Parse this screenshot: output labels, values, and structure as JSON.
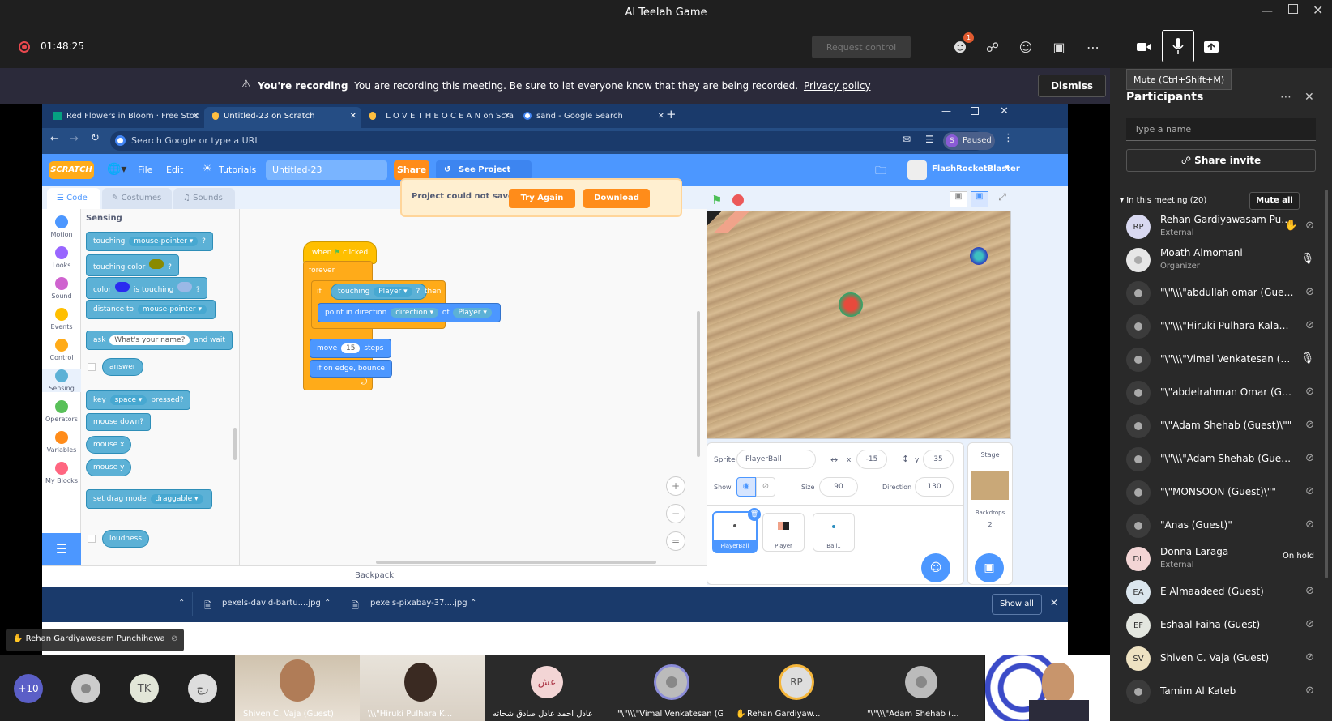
{
  "window": {
    "title": "Al Teelah Game"
  },
  "meeting": {
    "timer": "01:48:25",
    "request_control": "Request control",
    "people_badge": "1",
    "mute_tooltip": "Mute (Ctrl+Shift+M)"
  },
  "recording": {
    "bold": "You're recording",
    "text": "You are recording this meeting. Be sure to let everyone know that they are being recorded.",
    "link": "Privacy policy",
    "dismiss": "Dismiss"
  },
  "browser": {
    "tabs": [
      {
        "label": "Red Flowers in Bloom · Free Stoc"
      },
      {
        "label": "Untitled-23 on Scratch"
      },
      {
        "label": "I L O V E T H E O C E A N on Scra"
      },
      {
        "label": "sand - Google Search"
      }
    ],
    "address_placeholder": "Search Google or type a URL",
    "profile_label": "Paused",
    "profile_initial": "S"
  },
  "scratch": {
    "logo": "SCRATCH",
    "menu_file": "File",
    "menu_edit": "Edit",
    "menu_tutorials": "Tutorials",
    "project_title": "Untitled-23",
    "share": "Share",
    "see_project": "See Project Page",
    "username": "FlashRocketBlaster",
    "tab_code": "Code",
    "tab_costumes": "Costumes",
    "tab_sounds": "Sounds",
    "alert_text": "Project could not save.",
    "try_again": "Try Again",
    "download": "Download",
    "categories": [
      "Motion",
      "Looks",
      "Sound",
      "Events",
      "Control",
      "Sensing",
      "Operators",
      "Variables",
      "My Blocks"
    ],
    "category_colors": [
      "#4c97ff",
      "#9966ff",
      "#cf63cf",
      "#ffbf00",
      "#ffab19",
      "#5cb1d6",
      "#59c059",
      "#ff8c1a",
      "#ff6680"
    ],
    "palette_heading": "Sensing",
    "blocks": {
      "touching": "touching",
      "mouse_pointer": "mouse-pointer",
      "touching_color": "touching color",
      "color": "color",
      "is_touching": "is touching",
      "distance_to": "distance to",
      "ask": "ask",
      "ask_default": "What's your name?",
      "and_wait": "and wait",
      "answer": "answer",
      "key": "key",
      "space": "space",
      "pressed": "pressed?",
      "mouse_down": "mouse down?",
      "mouse_x": "mouse x",
      "mouse_y": "mouse y",
      "set_drag_mode": "set drag mode",
      "draggable": "draggable",
      "loudness": "loudness",
      "q": "?"
    },
    "script": {
      "when": "when",
      "clicked": "clicked",
      "forever": "forever",
      "if": "if",
      "touching": "touching",
      "player": "Player",
      "q": "?",
      "then": "then",
      "point_in_direction": "point in direction",
      "direction": "direction",
      "of": "of",
      "move": "move",
      "steps_value": "15",
      "steps": "steps",
      "bounce": "if on edge, bounce"
    },
    "sprite_info": {
      "sprite_label": "Sprite",
      "sprite_name": "PlayerBall",
      "x_label": "x",
      "x_value": "-15",
      "y_label": "y",
      "y_value": "35",
      "show_label": "Show",
      "size_label": "Size",
      "size_value": "90",
      "direction_label": "Direction",
      "direction_value": "130"
    },
    "sprites": [
      "PlayerBall",
      "Player",
      "Ball1"
    ],
    "stage_label": "Stage",
    "backdrops_label": "Backdrops",
    "backdrops_count": "2",
    "backpack": "Backpack"
  },
  "downloads": {
    "items": [
      "pexels-david-bartu....jpg",
      "pexels-pixabay-37....jpg"
    ],
    "show_all": "Show all"
  },
  "raised_hand": "Rehan Gardiyawasam Punchihewa",
  "participants": {
    "title": "Participants",
    "search_placeholder": "Type a name",
    "share_invite": "Share invite",
    "section": "In this meeting (20)",
    "mute_all": "Mute all",
    "list": [
      {
        "initials": "RP",
        "name": "Rehan Gardiyawasam Pun...",
        "role": "External",
        "color": "#d8d8f0"
      },
      {
        "initials": "",
        "name": "Moath Almomani",
        "role": "Organizer",
        "color": "#e6e6e6"
      },
      {
        "initials": "",
        "name": "\"\\\"\\\\\\\"abdullah omar (Guest)\\...",
        "role": "",
        "color": "#3b3b3b"
      },
      {
        "initials": "",
        "name": "\"\\\"\\\\\\\"Hiruki Pulhara Kalansoo...",
        "role": "",
        "color": "#3b3b3b"
      },
      {
        "initials": "",
        "name": "\"\\\"\\\\\\\"Vimal Venkatesan (Gu...",
        "role": "",
        "color": "#3b3b3b"
      },
      {
        "initials": "",
        "name": "\"\\\"abdelrahman Omar (Guest)\"",
        "role": "",
        "color": "#3b3b3b"
      },
      {
        "initials": "",
        "name": "\"\\\"Adam Shehab (Guest)\\\"\"",
        "role": "",
        "color": "#3b3b3b"
      },
      {
        "initials": "",
        "name": "\"\\\"\\\\\\\"Adam Shehab (Guest)\\\\...",
        "role": "",
        "color": "#3b3b3b"
      },
      {
        "initials": "",
        "name": "\"\\\"MONSOON (Guest)\\\"\"",
        "role": "",
        "color": "#3b3b3b"
      },
      {
        "initials": "",
        "name": "\"Anas (Guest)\"",
        "role": "",
        "color": "#3b3b3b"
      },
      {
        "initials": "DL",
        "name": "Donna Laraga",
        "role": "External",
        "color": "#f3d5d5"
      },
      {
        "initials": "EA",
        "name": "E Almaadeed (Guest)",
        "role": "",
        "color": "#dbe6ee"
      },
      {
        "initials": "EF",
        "name": "Eshaal Faiha (Guest)",
        "role": "",
        "color": "#e3e6df"
      },
      {
        "initials": "SV",
        "name": "Shiven C. Vaja (Guest)",
        "role": "",
        "color": "#eee2c2"
      },
      {
        "initials": "",
        "name": "Tamim Al Kateb",
        "role": "",
        "color": "#3b3b3b"
      }
    ],
    "on_hold": "On hold"
  },
  "gallery": {
    "overflow": "+10",
    "tk": "TK",
    "rj": "رج",
    "arabic_initials": "عش",
    "rp": "RP",
    "names": [
      "Shiven C. Vaja (Guest)",
      "\\\\\\\"Hiruki Pulhara K...",
      "عادل احمد عادل صادق شحاته",
      "\"\\\"\\\\\\\"Vimal Venkatesan (G...",
      "Rehan Gardiyaw...",
      "\"\\\"\\\\\\\"Adam Shehab (..."
    ]
  }
}
